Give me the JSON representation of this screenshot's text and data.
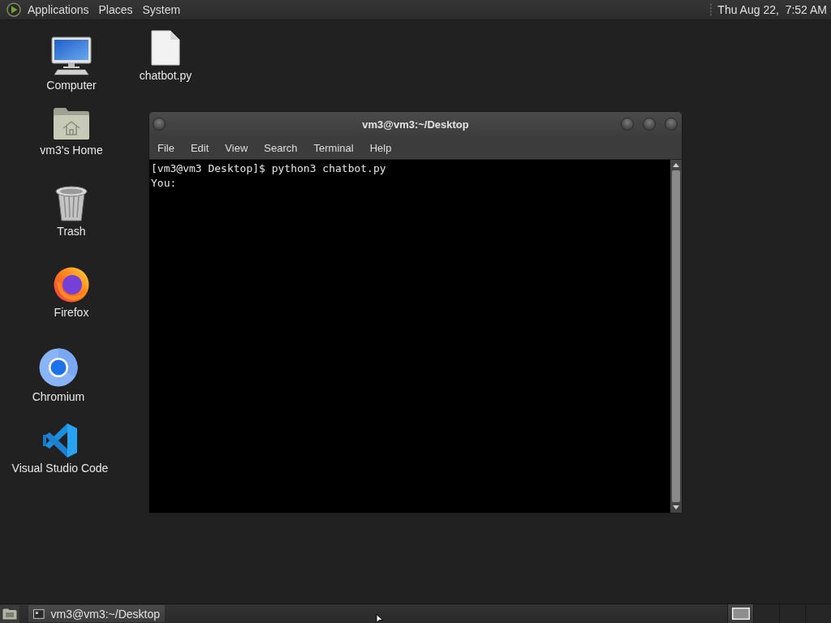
{
  "top_panel": {
    "menus": [
      "Applications",
      "Places",
      "System"
    ],
    "clock": "Thu Aug 22,  7:52 AM"
  },
  "desktop_icons": [
    {
      "kind": "computer",
      "label": "Computer"
    },
    {
      "kind": "file",
      "label": "chatbot.py"
    },
    {
      "kind": "home",
      "label": "vm3's Home"
    },
    {
      "kind": "trash",
      "label": "Trash"
    },
    {
      "kind": "firefox",
      "label": "Firefox"
    },
    {
      "kind": "chromium",
      "label": "Chromium"
    },
    {
      "kind": "vscode",
      "label": "Visual Studio Code"
    }
  ],
  "terminal_window": {
    "title": "vm3@vm3:~/Desktop",
    "menus": [
      "File",
      "Edit",
      "View",
      "Search",
      "Terminal",
      "Help"
    ],
    "lines": [
      "[vm3@vm3 Desktop]$ python3 chatbot.py",
      "You:"
    ]
  },
  "bottom_panel": {
    "tasks": [
      {
        "label": "vm3@vm3:~/Desktop",
        "selected": true
      }
    ],
    "workspaces": [
      {
        "selected": true,
        "has_window": true
      },
      {
        "selected": false,
        "has_window": false
      },
      {
        "selected": false,
        "has_window": false
      },
      {
        "selected": false,
        "has_window": false
      }
    ]
  }
}
